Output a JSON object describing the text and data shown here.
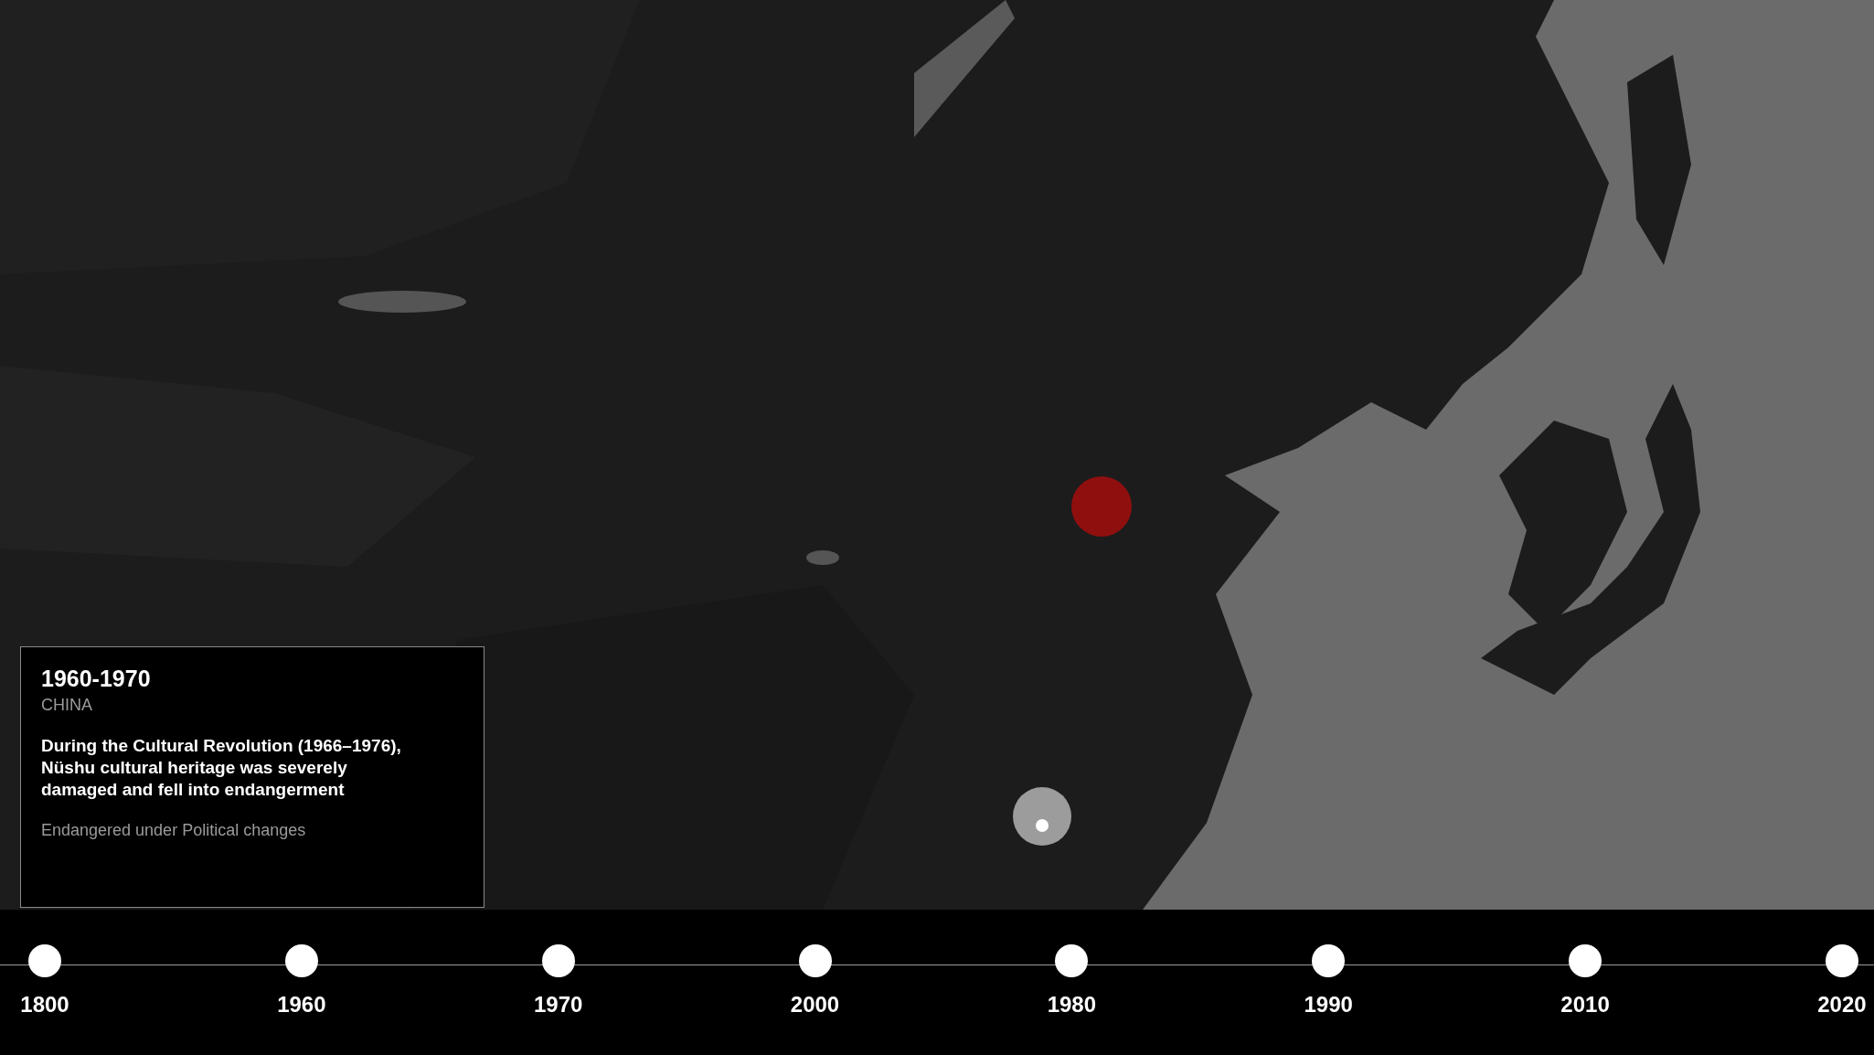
{
  "map": {
    "markers": [
      {
        "color": "#8f0f0f",
        "pin": false
      },
      {
        "color": "#9c9c9c",
        "pin": true
      }
    ]
  },
  "info_card": {
    "period": "1960-1970",
    "region": "CHINA",
    "description": "During the Cultural Revolution (1966–1976), Nüshu cultural heritage was severely damaged and fell into endangerment",
    "status": "Endangered under Political changes"
  },
  "timeline": {
    "points": [
      {
        "label": "1800"
      },
      {
        "label": "1960"
      },
      {
        "label": "1970"
      },
      {
        "label": "2000"
      },
      {
        "label": "1980"
      },
      {
        "label": "1990"
      },
      {
        "label": "2010"
      },
      {
        "label": "2020"
      }
    ]
  }
}
